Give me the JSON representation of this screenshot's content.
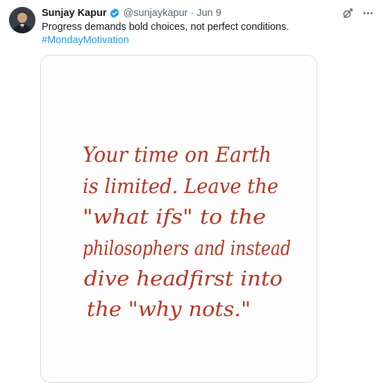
{
  "tweet": {
    "display_name": "Sunjay Kapur",
    "handle": "@sunjaykapur",
    "separator": "·",
    "date": "Jun 9",
    "text": "Progress demands bold choices, not perfect conditions.",
    "hashtag": "#MondayMotivation"
  },
  "icons": {
    "verified": "verified-badge-icon",
    "grok": "grok-icon",
    "more": "more-icon"
  },
  "media": {
    "handwritten_quote": [
      "Your time on Earth",
      "is limited. Leave the",
      "\"what ifs\" to the",
      "philosophers and instead",
      "dive headfirst into",
      "the \"why nots.\""
    ]
  },
  "colors": {
    "link": "#1d9bf0",
    "verified": "#1d9bf0",
    "ink": "#b8321f",
    "text": "#0f1419",
    "muted": "#536471"
  }
}
